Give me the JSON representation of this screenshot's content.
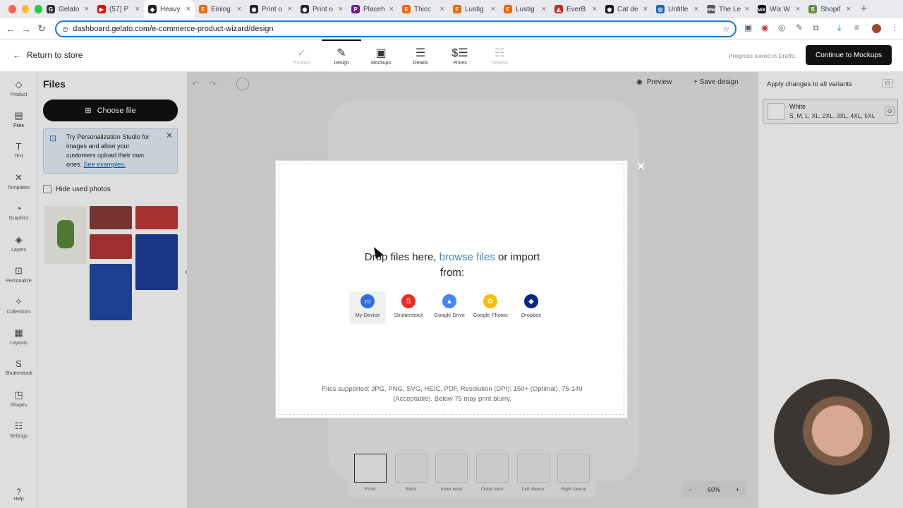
{
  "browser": {
    "tabs": [
      {
        "label": "Gelato",
        "color": "#333",
        "glyph": "G"
      },
      {
        "label": "(57) P",
        "color": "#e00",
        "glyph": "▶"
      },
      {
        "label": "Heavy",
        "color": "#222",
        "glyph": "◆",
        "active": true
      },
      {
        "label": "Einlog",
        "color": "#f56400",
        "glyph": "E"
      },
      {
        "label": "Print o",
        "color": "#222",
        "glyph": "◉"
      },
      {
        "label": "Print o",
        "color": "#222",
        "glyph": "◉"
      },
      {
        "label": "Placeh",
        "color": "#6a1b9a",
        "glyph": "P"
      },
      {
        "label": "Thicc",
        "color": "#f56400",
        "glyph": "E"
      },
      {
        "label": "Lustig",
        "color": "#f56400",
        "glyph": "E"
      },
      {
        "label": "Lustig",
        "color": "#f56400",
        "glyph": "E"
      },
      {
        "label": "EverB",
        "color": "#c62828",
        "glyph": "◭"
      },
      {
        "label": "Cat de",
        "color": "#111",
        "glyph": "◉"
      },
      {
        "label": "Untitle",
        "color": "#1565c0",
        "glyph": "◎"
      },
      {
        "label": "The Le",
        "color": "#555",
        "glyph": "ww"
      },
      {
        "label": "Wix W",
        "color": "#111",
        "glyph": "wx"
      },
      {
        "label": "Shopif",
        "color": "#5e8e3e",
        "glyph": "S"
      }
    ],
    "url": "dashboard.gelato.com/e-commerce-product-wizard/design"
  },
  "topnav": {
    "back": "Return to store",
    "steps": [
      {
        "label": "Product",
        "icon": "✓",
        "state": "dim"
      },
      {
        "label": "Design",
        "icon": "✎",
        "state": "active"
      },
      {
        "label": "Mockups",
        "icon": "▣",
        "state": "normal"
      },
      {
        "label": "Details",
        "icon": "☰",
        "state": "normal"
      },
      {
        "label": "Prices",
        "icon": "$☰",
        "state": "normal"
      },
      {
        "label": "Review",
        "icon": "☷",
        "state": "dim"
      }
    ],
    "saved": "Progress saved in Drafts.",
    "continue": "Continue to Mockups"
  },
  "rail": [
    {
      "label": "Product",
      "icon": "◇"
    },
    {
      "label": "Files",
      "icon": "▤",
      "active": true
    },
    {
      "label": "Text",
      "icon": "T"
    },
    {
      "label": "Templates",
      "icon": "✕"
    },
    {
      "label": "Graphics",
      "icon": "◔"
    },
    {
      "label": "Layers",
      "icon": "◈"
    },
    {
      "label": "Personalize",
      "icon": "⊡"
    },
    {
      "label": "Collections",
      "icon": "✧"
    },
    {
      "label": "Layouts",
      "icon": "▦"
    },
    {
      "label": "Shutterstock",
      "icon": "S"
    },
    {
      "label": "Shapes",
      "icon": "◳"
    },
    {
      "label": "Settings",
      "icon": "☷"
    }
  ],
  "help": "Help",
  "files": {
    "title": "Files",
    "choose": "Choose file",
    "promo_text": "Try Personalization Studio for images and allow your customers upload their own ones.",
    "promo_link": "See examples.",
    "hide_used": "Hide used photos"
  },
  "canvas": {
    "preview": "Preview",
    "save": "Save design",
    "views": [
      "Front",
      "Back",
      "Inner neck",
      "Outer neck",
      "Left sleeve",
      "Right sleeve"
    ],
    "zoom": "60%"
  },
  "variants": {
    "title": "Apply changes to all variants",
    "name": "White",
    "sizes": "S, M, L, XL, 2XL, 3XL, 4XL, 5XL"
  },
  "modal": {
    "drop_pre": "Drop files here, ",
    "drop_link": "browse files",
    "drop_post": " or import from:",
    "sources": [
      {
        "label": "My Device",
        "icon": "▭",
        "color": "#2e6fd8"
      },
      {
        "label": "Shutterstock",
        "icon": "S",
        "color": "#ee2b24"
      },
      {
        "label": "Google Drive",
        "icon": "▲",
        "color": "#4285f4"
      },
      {
        "label": "Google Photos",
        "icon": "✿",
        "color": "#fbbc05"
      },
      {
        "label": "Dropbox",
        "icon": "◆",
        "color": "#0d2481"
      }
    ],
    "supported": "Files supported: JPG, PNG, SVG, HEIC, PDF. Resolution (DPI): 150+ (Optimal), 75-149 (Acceptable). Below 75 may print blurry."
  }
}
